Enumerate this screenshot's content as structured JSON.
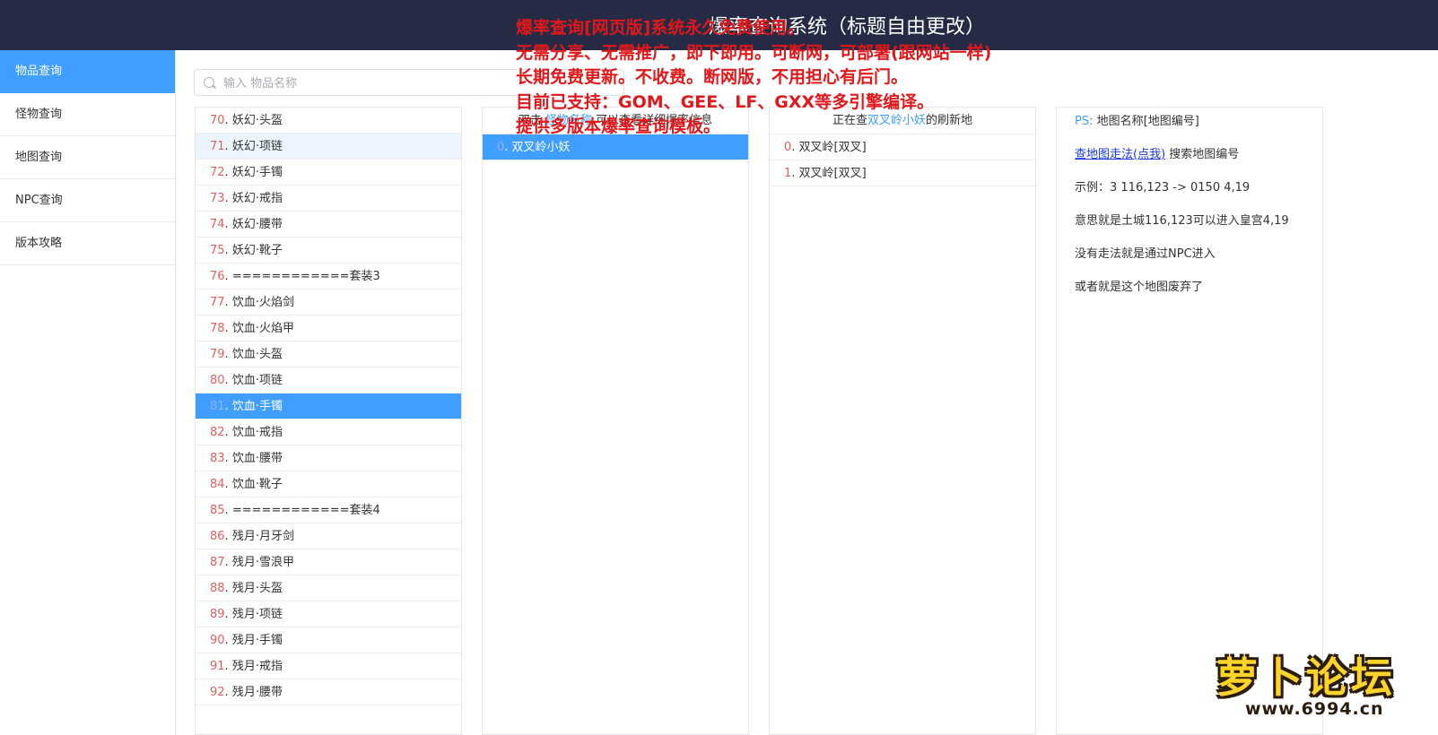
{
  "header": {
    "title": "爆率查询系统（标题自由更改）"
  },
  "sidebar": {
    "items": [
      {
        "label": "物品查询"
      },
      {
        "label": "怪物查询"
      },
      {
        "label": "地图查询"
      },
      {
        "label": "NPC查询"
      },
      {
        "label": "版本攻略"
      }
    ]
  },
  "search": {
    "placeholder": "输入 物品名称",
    "value": ""
  },
  "items": [
    {
      "num": "70",
      "name": "妖幻·头盔"
    },
    {
      "num": "71",
      "name": "妖幻·项链"
    },
    {
      "num": "72",
      "name": "妖幻·手镯"
    },
    {
      "num": "73",
      "name": "妖幻·戒指"
    },
    {
      "num": "74",
      "name": "妖幻·腰带"
    },
    {
      "num": "75",
      "name": "妖幻·靴子"
    },
    {
      "num": "76",
      "name": "============套装3"
    },
    {
      "num": "77",
      "name": "饮血·火焰剑"
    },
    {
      "num": "78",
      "name": "饮血·火焰甲"
    },
    {
      "num": "79",
      "name": "饮血·头盔"
    },
    {
      "num": "80",
      "name": "饮血·项链"
    },
    {
      "num": "81",
      "name": "饮血·手镯"
    },
    {
      "num": "82",
      "name": "饮血·戒指"
    },
    {
      "num": "83",
      "name": "饮血·腰带"
    },
    {
      "num": "84",
      "name": "饮血·靴子"
    },
    {
      "num": "85",
      "name": "============套装4"
    },
    {
      "num": "86",
      "name": "残月·月牙剑"
    },
    {
      "num": "87",
      "name": "残月·雪浪甲"
    },
    {
      "num": "88",
      "name": "残月·头盔"
    },
    {
      "num": "89",
      "name": "残月·项链"
    },
    {
      "num": "90",
      "name": "残月·手镯"
    },
    {
      "num": "91",
      "name": "残月·戒指"
    },
    {
      "num": "92",
      "name": "残月·腰带"
    }
  ],
  "monster_panel": {
    "hint_prefix": "双击",
    "hint_link": "怪物名称",
    "hint_suffix": "可以查看详细爆率信息",
    "rows": [
      {
        "num": "0",
        "name": "双叉岭小妖"
      }
    ]
  },
  "map_panel": {
    "header_prefix": "正在查",
    "header_monster": "双叉岭小妖",
    "header_suffix": "的刷新地",
    "rows": [
      {
        "num": "0",
        "name": "双叉岭[双叉]"
      },
      {
        "num": "1",
        "name": "双叉岭[双叉]"
      }
    ]
  },
  "info_panel": {
    "ps_label": "PS:",
    "ps_text": "地图名称[地图编号]",
    "link": "查地图走法(点我)",
    "link_suffix": "搜索地图编号",
    "lines": [
      "示例：3 116,123 -> 0150 4,19",
      "意思就是土城116,123可以进入皇宫4,19",
      "没有走法就是通过NPC进入",
      "或者就是这个地图废弃了"
    ]
  },
  "overlay_text": [
    "爆率查询[网页版]系统永久免费使用。",
    "无需分享、无需推广，即下即用。可断网，可部署(跟网站一样)",
    "长期免费更新。不收费。断网版，不用担心有后门。",
    "目前已支持：GOM、GEE、LF、GXX等多引擎编译。",
    "提供多版本爆率查询模板。"
  ],
  "watermark": {
    "logo": "萝卜论坛",
    "url": "www.6994.cn"
  },
  "colors": {
    "header_bg": "#262b45",
    "accent": "#409eff",
    "number": "#e0605e",
    "overlay": "#e0181b"
  }
}
